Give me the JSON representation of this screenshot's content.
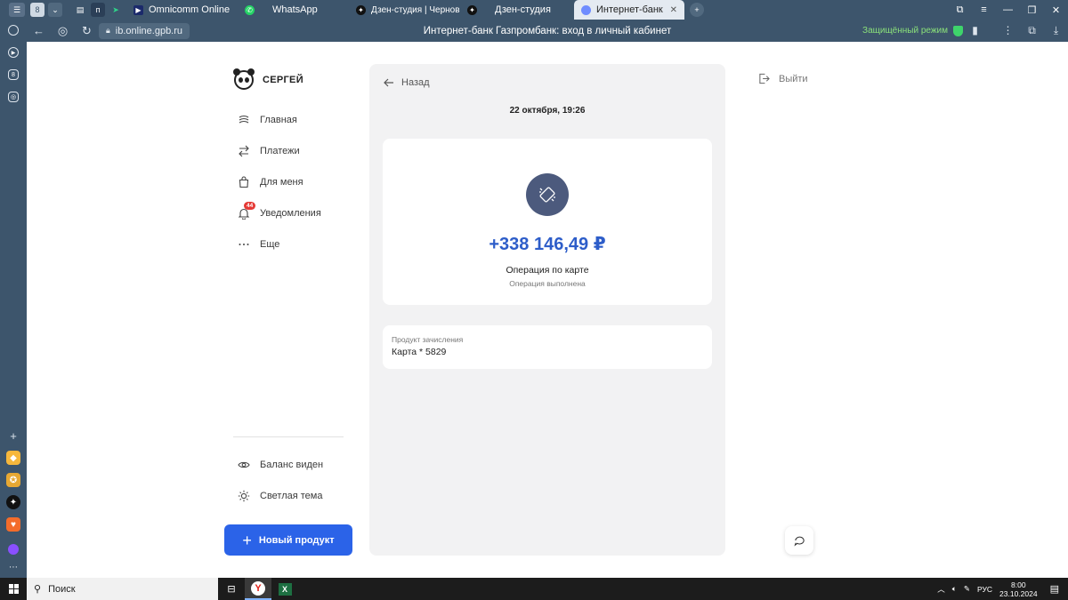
{
  "browser": {
    "tabs": [
      {
        "label": "Omnicomm Online",
        "color": "#1b2a6b",
        "glyph": "▶"
      },
      {
        "label": "WhatsApp",
        "color": "#25d366",
        "glyph": "✆"
      },
      {
        "label": "Дзен-студия | Черновик",
        "color": "#111111",
        "glyph": "✦"
      },
      {
        "label": "Дзен-студия",
        "color": "#111111",
        "glyph": "✦"
      },
      {
        "label": "Интернет-банк Газпр",
        "color": "#6f8cff",
        "glyph": "◉"
      }
    ],
    "url": "ib.online.gpb.ru",
    "page_title": "Интернет-банк Газпромбанк: вход в личный кабинет",
    "secure_label": "Защищённый режим"
  },
  "sidebar": {
    "user_name": "СЕРГЕЙ",
    "menu": [
      {
        "label": "Главная",
        "icon": "home-icon"
      },
      {
        "label": "Платежи",
        "icon": "transfer-icon"
      },
      {
        "label": "Для меня",
        "icon": "bag-icon"
      },
      {
        "label": "Уведомления",
        "icon": "bell-icon"
      },
      {
        "label": "Еще",
        "icon": "more-icon"
      }
    ],
    "notifications_count": "44",
    "balance_label": "Баланс виден",
    "theme_label": "Светлая тема",
    "new_product_label": "Новый продукт"
  },
  "operation": {
    "back_label": "Назад",
    "datetime": "22 октября, 19:26",
    "amount": "+338 146,49 ₽",
    "title": "Операция по карте",
    "status": "Операция выполнена",
    "product_label": "Продукт зачисления",
    "product_value": "Карта * 5829"
  },
  "header": {
    "logout_label": "Выйти"
  },
  "taskbar": {
    "search_label": "Поиск",
    "language": "РУС",
    "time": "8:00",
    "date": "23.10.2024"
  },
  "colors": {
    "accent": "#2b63e8",
    "amount": "#2d5dc9",
    "chrome": "#3d556c"
  }
}
